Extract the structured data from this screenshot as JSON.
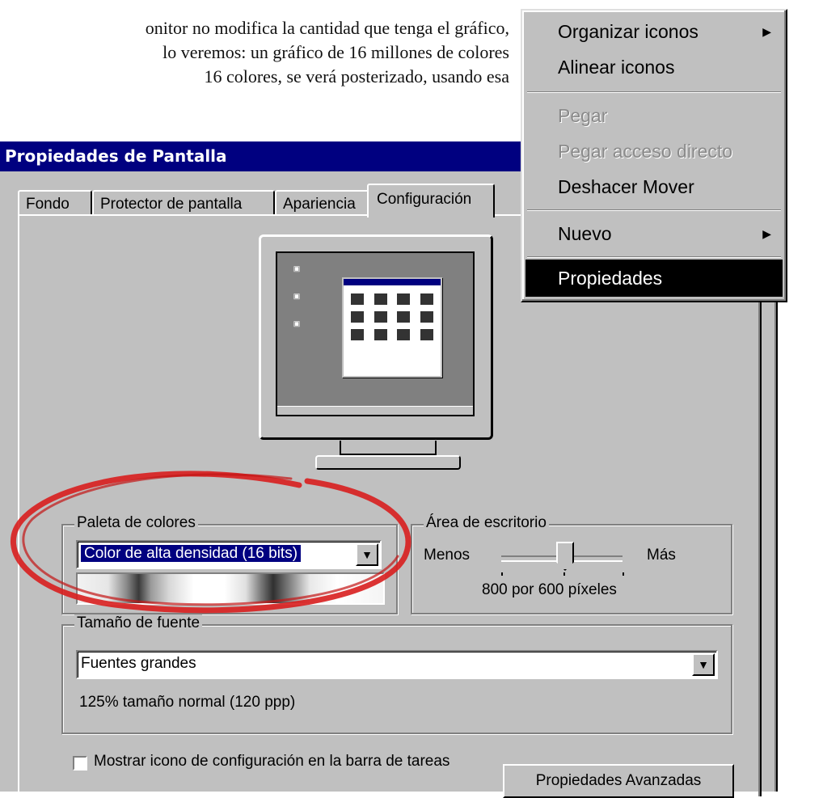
{
  "article": {
    "lines": [
      "onitor no modifica la cantidad que tenga el gráfico,",
      "lo veremos: un gráfico de 16 millones de colores",
      "16 colores, se verá posterizado, usando esa"
    ]
  },
  "dialog": {
    "title": "Propiedades de Pantalla",
    "tabs": [
      "Fondo",
      "Protector de pantalla",
      "Apariencia",
      "Configuración"
    ],
    "active_tab": "Configuración",
    "palette": {
      "label": "Paleta de colores",
      "selected": "Color de alta densidad (16 bits)"
    },
    "desktop_area": {
      "label": "Área de escritorio",
      "less": "Menos",
      "more": "Más",
      "resolution": "800 por 600 píxeles"
    },
    "font_size": {
      "label": "Tamaño de fuente",
      "selected": "Fuentes grandes",
      "note": "125% tamaño normal (120 ppp)"
    },
    "checkbox_label": "Mostrar icono de configuración en la barra de tareas",
    "advanced_button": "Propiedades Avanzadas"
  },
  "context_menu": {
    "items": [
      {
        "label": "Organizar iconos",
        "submenu": true,
        "disabled": false
      },
      {
        "label": "Alinear iconos",
        "submenu": false,
        "disabled": false
      },
      {
        "label": "Pegar",
        "submenu": false,
        "disabled": true
      },
      {
        "label": "Pegar acceso directo",
        "submenu": false,
        "disabled": true
      },
      {
        "label": "Deshacer Mover",
        "submenu": false,
        "disabled": false
      },
      {
        "label": "Nuevo",
        "submenu": true,
        "disabled": false
      },
      {
        "label": "Propiedades",
        "submenu": false,
        "disabled": false,
        "highlighted": true
      }
    ]
  },
  "colors": {
    "titlebar": "#000080",
    "dialog_face": "#c0c0c0",
    "highlight": "#000000",
    "annotation_circle": "#d81e1e"
  }
}
